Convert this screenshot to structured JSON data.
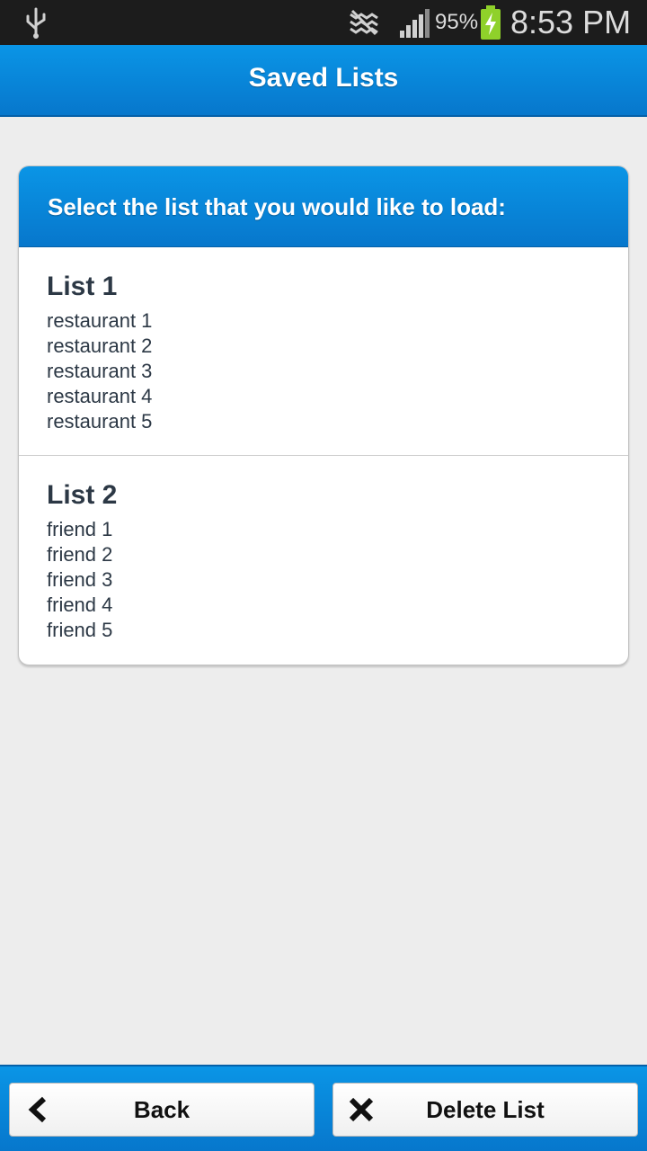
{
  "status_bar": {
    "battery_percent": "95%",
    "time": "8:53 PM",
    "icons": [
      "usb-icon",
      "mute-icon",
      "signal-icon",
      "battery-charging-icon"
    ]
  },
  "header": {
    "title": "Saved Lists"
  },
  "card": {
    "prompt": "Select the list that you would like to load:",
    "lists": [
      {
        "name": "List 1",
        "items": [
          "restaurant 1",
          "restaurant 2",
          "restaurant 3",
          "restaurant 4",
          "restaurant 5"
        ]
      },
      {
        "name": "List 2",
        "items": [
          "friend 1",
          "friend 2",
          "friend 3",
          "friend 4",
          "friend 5"
        ]
      }
    ]
  },
  "footer": {
    "back_label": "Back",
    "delete_label": "Delete List",
    "icons": [
      "chevron-left-icon",
      "close-icon"
    ]
  },
  "colors": {
    "accent": "#0a8ee0",
    "background": "#ededed",
    "text": "#2c3845"
  }
}
